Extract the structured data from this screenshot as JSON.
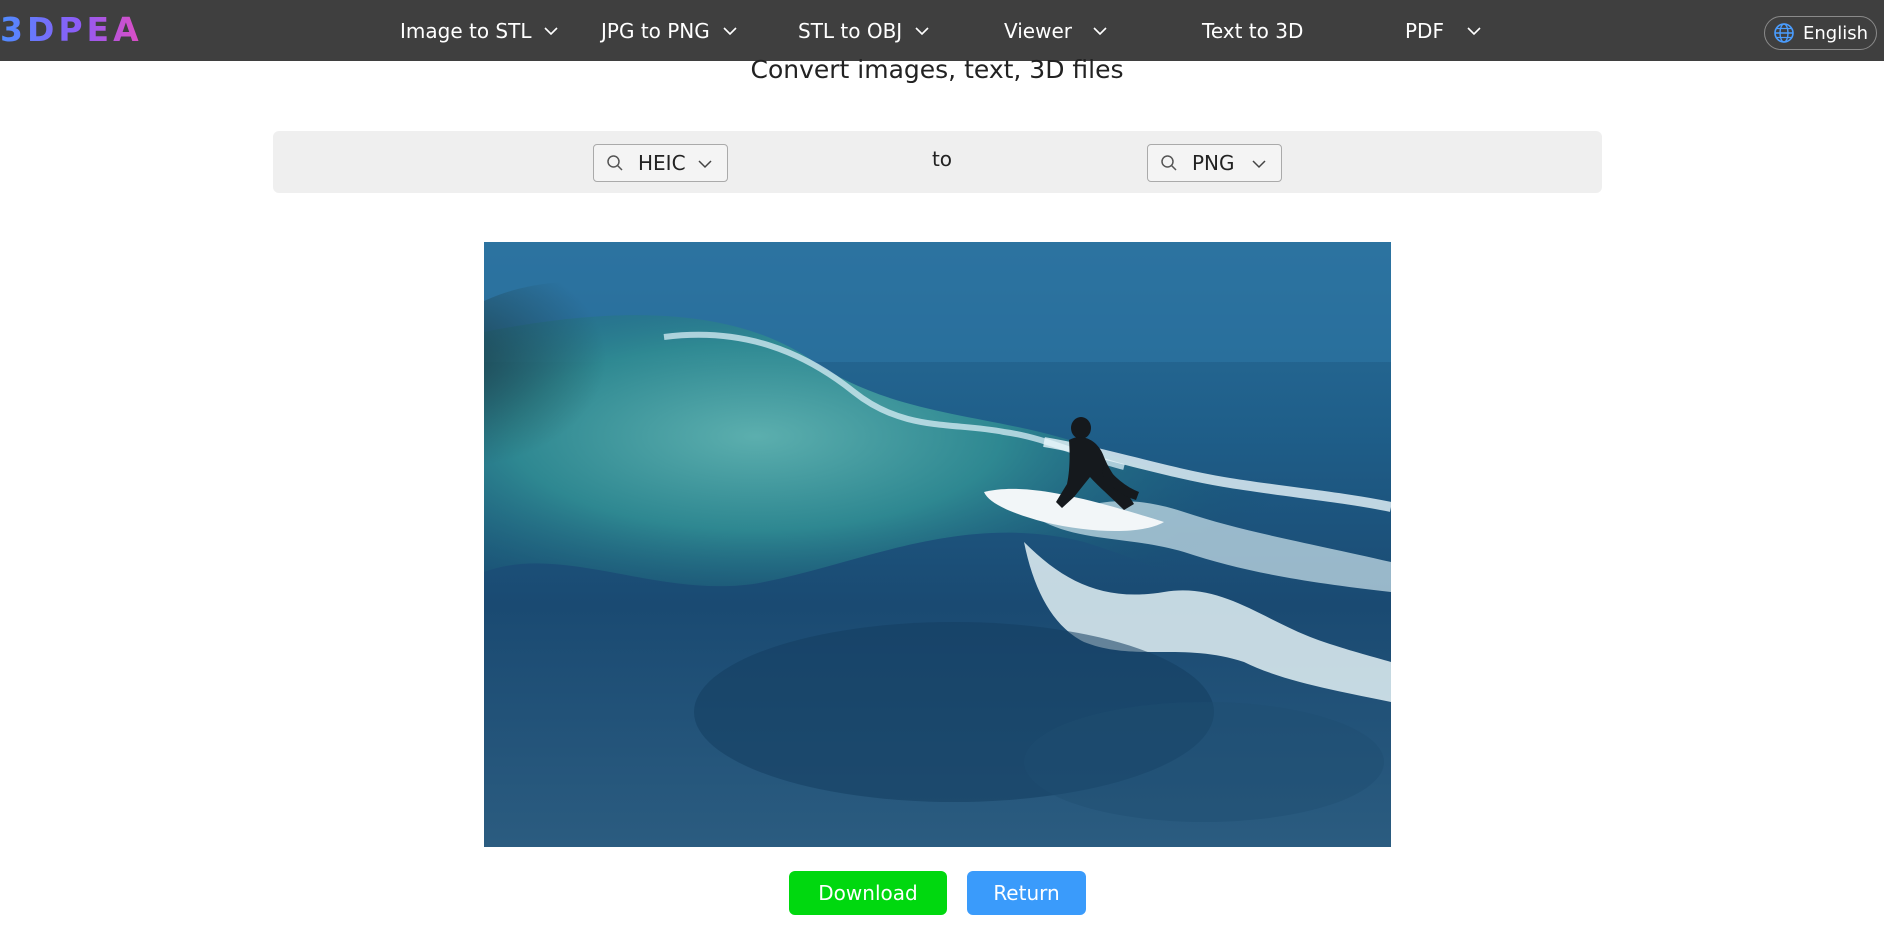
{
  "header": {
    "logo_text": "3DPEA",
    "nav": [
      {
        "label": "Image to STL",
        "has_dropdown": true
      },
      {
        "label": "JPG to PNG",
        "has_dropdown": true
      },
      {
        "label": "STL to OBJ",
        "has_dropdown": true
      },
      {
        "label": "Viewer",
        "has_dropdown": true
      },
      {
        "label": "Text to 3D",
        "has_dropdown": false
      },
      {
        "label": "PDF",
        "has_dropdown": true
      }
    ],
    "language": "English",
    "icons": {
      "language": "globe-icon",
      "dropdown": "chevron-down-icon"
    }
  },
  "main": {
    "subtitle": "Convert images, text, 3D files",
    "converter": {
      "from_format": "HEIC",
      "connector": "to",
      "to_format": "PNG",
      "icons": {
        "select": "search-icon",
        "dropdown": "chevron-down-icon"
      }
    },
    "actions": {
      "download_label": "Download",
      "return_label": "Return"
    }
  },
  "colors": {
    "header_bg": "#3f3f3f",
    "convert_bar_bg": "#efefef",
    "download": "#00d80f",
    "return": "#3a9bfb"
  }
}
